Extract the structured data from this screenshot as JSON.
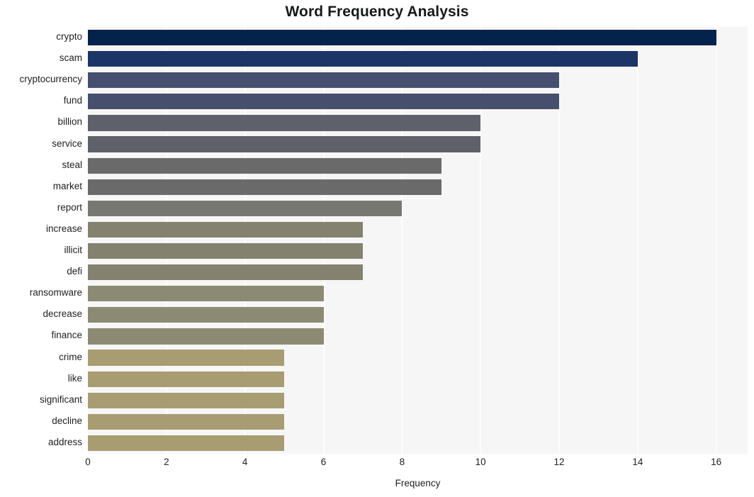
{
  "chart_data": {
    "type": "bar",
    "orientation": "horizontal",
    "title": "Word Frequency Analysis",
    "xlabel": "Frequency",
    "ylabel": "",
    "categories": [
      "crypto",
      "scam",
      "cryptocurrency",
      "fund",
      "billion",
      "service",
      "steal",
      "market",
      "report",
      "increase",
      "illicit",
      "defi",
      "ransomware",
      "decrease",
      "finance",
      "crime",
      "like",
      "significant",
      "decline",
      "address"
    ],
    "values": [
      16,
      14,
      12,
      12,
      10,
      10,
      9,
      9,
      8,
      7,
      7,
      7,
      6,
      6,
      6,
      5,
      5,
      5,
      5,
      5
    ],
    "xlim": [
      0,
      16.8
    ],
    "xticks": [
      0,
      2,
      4,
      6,
      8,
      10,
      12,
      14,
      16
    ],
    "xticklabels": [
      "0",
      "2",
      "4",
      "6",
      "8",
      "10",
      "12",
      "14",
      "16"
    ],
    "grid": true,
    "grid_axis": "x",
    "grid_color": "#fdfdfd",
    "legend": false,
    "plot_background": "#f6f6f6",
    "figure_background": "#ffffff",
    "bar_colors": [
      "#03224c",
      "#1c3567",
      "#474f6f",
      "#474f6f",
      "#5e6169",
      "#5e6169",
      "#696a69",
      "#696a69",
      "#787873",
      "#84826f",
      "#84826f",
      "#84826f",
      "#8d8a74",
      "#8d8a74",
      "#8d8a74",
      "#a89d72",
      "#a89d72",
      "#a89d72",
      "#a89d72",
      "#a89d72"
    ]
  }
}
